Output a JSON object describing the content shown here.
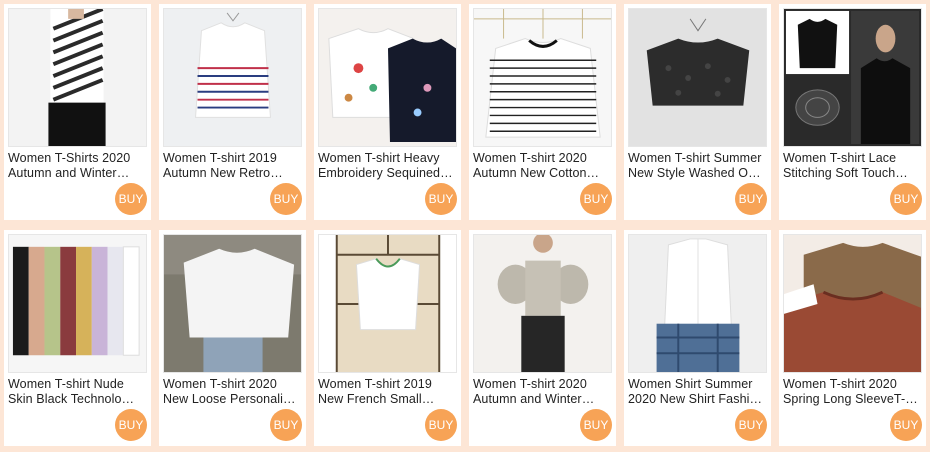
{
  "colors": {
    "page_bg": "#fde6d6",
    "buy_button": "#f7a356"
  },
  "products": [
    {
      "line1": "Women T-Shirts 2020",
      "line2": "Autumn and Winter…",
      "buy": "BUY",
      "image": "striped-turtleneck-photo"
    },
    {
      "line1": "Women T-shirt 2019",
      "line2": "Autumn New Retro…",
      "buy": "BUY",
      "image": "red-blue-stripe-tee-photo"
    },
    {
      "line1": "Women T-shirt Heavy",
      "line2": "Embroidery Sequined…",
      "buy": "BUY",
      "image": "embroidered-tees-photo"
    },
    {
      "line1": "Women T-shirt 2020",
      "line2": "Autumn New Cotton…",
      "buy": "BUY",
      "image": "black-stripe-tee-photo"
    },
    {
      "line1": "Women T-shirt Summer",
      "line2": "New Style Washed O…",
      "buy": "BUY",
      "image": "black-crop-tee-photo"
    },
    {
      "line1": "Women T-shirt Lace",
      "line2": "Stitching Soft Touch…",
      "buy": "BUY",
      "image": "black-lace-tee-photo"
    },
    {
      "line1": "Women T-shirt Nude",
      "line2": "Skin Black Technolo…",
      "buy": "BUY",
      "image": "color-tees-hanging-photo"
    },
    {
      "line1": "Women T-shirt 2020",
      "line2": "New Loose Personali…",
      "buy": "BUY",
      "image": "white-loose-tee-photo"
    },
    {
      "line1": "Women T-shirt 2019",
      "line2": "New French Small…",
      "buy": "BUY",
      "image": "white-square-neck-tee-photo"
    },
    {
      "line1": "Women T-shirt 2020",
      "line2": "Autumn and Winter…",
      "buy": "BUY",
      "image": "puff-sleeve-top-photo"
    },
    {
      "line1": "Women Shirt Summer",
      "line2": "2020 New Shirt Fashi…",
      "buy": "BUY",
      "image": "white-sleeveless-shirt-photo"
    },
    {
      "line1": "Women T-shirt 2020",
      "line2": "Spring Long SleeveT-…",
      "buy": "BUY",
      "image": "brown-tees-photo"
    }
  ]
}
